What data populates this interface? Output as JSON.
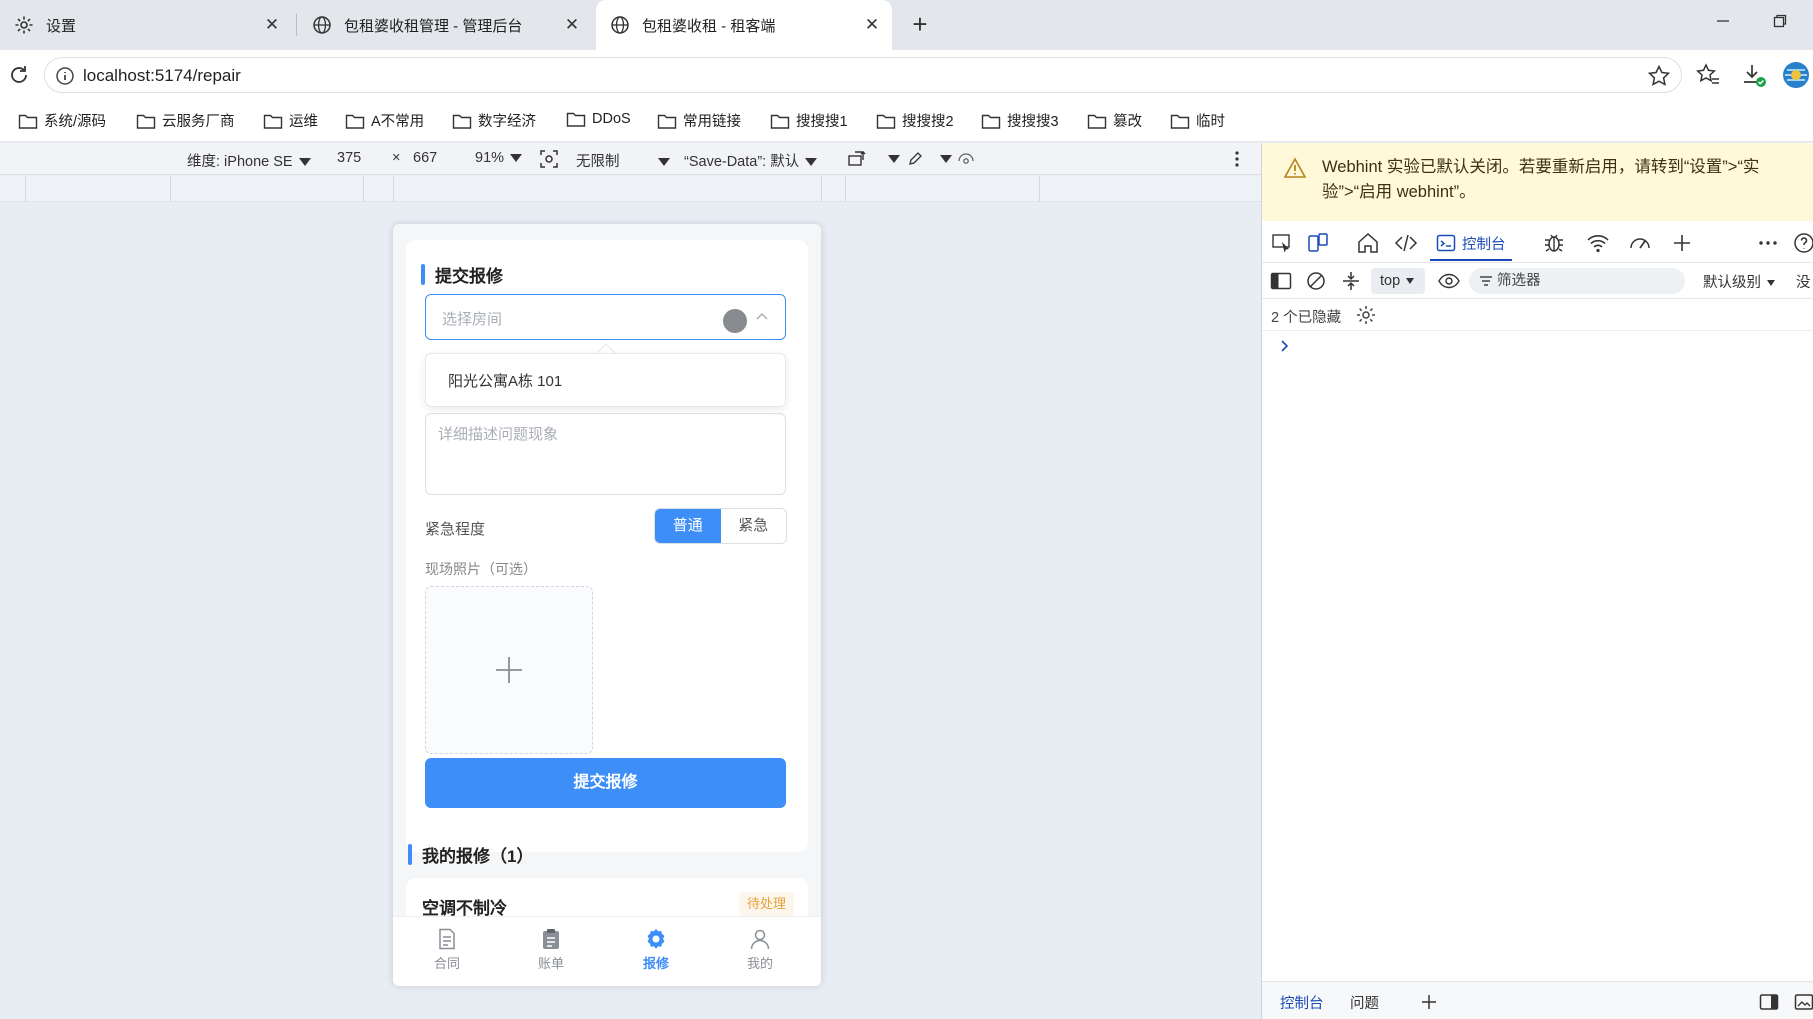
{
  "browser": {
    "tabs": [
      {
        "label": "设置",
        "icon": "gear-icon"
      },
      {
        "label": "包租婆收租管理 - 管理后台",
        "icon": "globe-icon"
      },
      {
        "label": "包租婆收租 - 租客端",
        "icon": "globe-icon",
        "active": true
      }
    ],
    "close_glyph": "✕",
    "new_tab_glyph": "+",
    "url": "localhost:5174/repair",
    "bookmarks": [
      "系统/源码",
      "云服务厂商",
      "运维",
      "A不常用",
      "数字经济",
      "DDoS",
      "常用链接",
      "搜搜搜1",
      "搜搜搜2",
      "搜搜搜3",
      "篡改",
      "临时"
    ]
  },
  "device_toolbar": {
    "dimension_label": "维度: iPhone SE",
    "width": "375",
    "times": "×",
    "height": "667",
    "zoom": "91%",
    "throttle": "无限制",
    "save_data": "“Save-Data”: 默认"
  },
  "app": {
    "submit_section_title": "提交报修",
    "room_select_placeholder": "选择房间",
    "room_option": "阳光公寓A栋 101",
    "description_placeholder": "详细描述问题现象",
    "urgency_label": "紧急程度",
    "urgency_options": [
      "普通",
      "紧急"
    ],
    "urgency_selected": "普通",
    "photos_label": "现场照片（可选）",
    "submit_button": "提交报修",
    "my_repairs_title": "我的报修（1）",
    "repair_items": [
      {
        "title": "空调不制冷",
        "status": "待处理"
      }
    ],
    "tabbar": [
      {
        "label": "合同",
        "icon": "document-icon"
      },
      {
        "label": "账单",
        "icon": "clipboard-icon"
      },
      {
        "label": "报修",
        "icon": "gear-icon",
        "active": true
      },
      {
        "label": "我的",
        "icon": "user-icon"
      }
    ]
  },
  "devtools": {
    "warning": "Webhint 实验已默认关闭。若要重新启用，请转到“设置”>“实验”>“启用 webhint”。",
    "console_tab": "控制台",
    "context": "top",
    "filter_placeholder": "筛选器",
    "level": "默认级别",
    "level_suffix": "没",
    "hidden_count": "2 个已隐藏",
    "bottom_tabs": [
      "控制台",
      "问题"
    ]
  },
  "colors": {
    "accent": "#3d8ef7",
    "warning_bg": "#fff8d9",
    "pending": "#e6a23c"
  }
}
